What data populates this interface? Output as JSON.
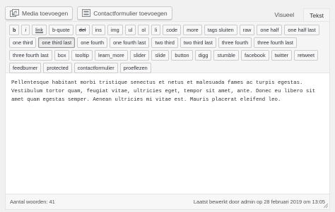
{
  "media": {
    "add_media_label": "Media toevoegen",
    "add_contact_form_label": "Contactformulier toevoegen"
  },
  "tabs": [
    {
      "label": "Visueel"
    },
    {
      "label": "Tekst"
    }
  ],
  "toolbar": {
    "buttons": [
      "b",
      "i",
      "link",
      "b-quote",
      "del",
      "ins",
      "img",
      "ul",
      "ol",
      "li",
      "code",
      "more",
      "tags sluiten",
      "raw",
      "one half",
      "one half last",
      "one third",
      "one third last",
      "one fourth",
      "one fourth last",
      "two third",
      "two third last",
      "three fourth",
      "three fourth last",
      "three fourth last",
      "box",
      "tooltip",
      "learn_more",
      "slider",
      "slide",
      "button",
      "digg",
      "stumble",
      "facebook",
      "twitter",
      "retweet",
      "feedburner",
      "protected",
      "contactformulier",
      "proeflezen"
    ]
  },
  "content": {
    "text": "Pellentesque habitant morbi tristique senectus et netus et malesuada fames ac turpis egestas. Vestibulum tortor quam, feugiat vitae, ultricies eget, tempor sit amet, ante. Donec eu libero sit amet quam egestas semper. Aenean ultricies mi vitae est. Mauris placerat eleifend leo."
  },
  "status": {
    "word_count_label": "Aantal woorden:",
    "word_count": "41",
    "last_edited": "Laatst bewerkt door admin op 28 februari 2019 om 13:05"
  },
  "icons": {
    "media": "media-icon",
    "contact_form": "contact-form-icon",
    "resize": "resize-grip-icon"
  }
}
